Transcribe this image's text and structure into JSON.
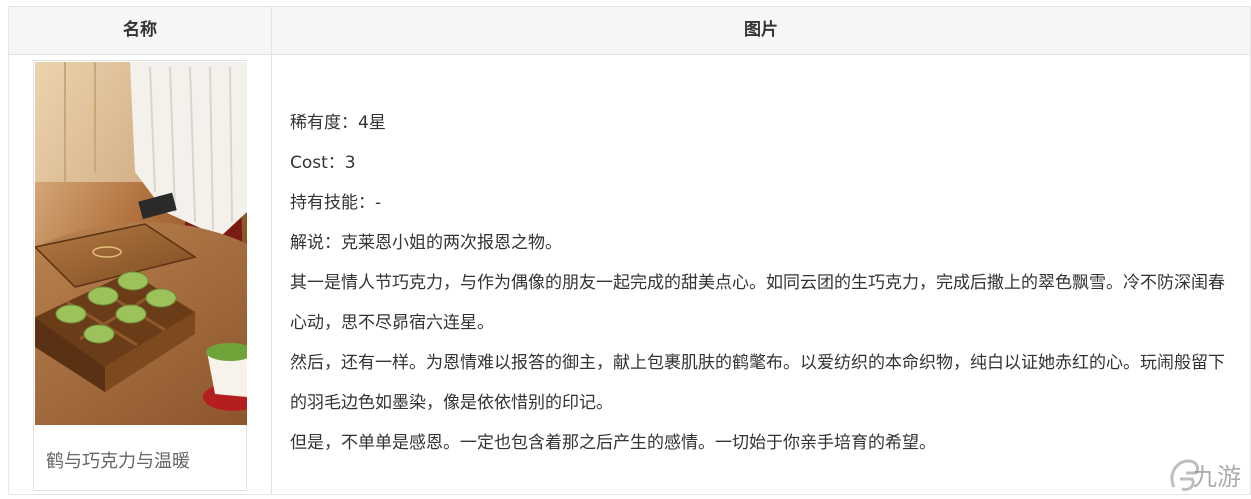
{
  "table": {
    "headers": {
      "name": "名称",
      "image": "图片"
    }
  },
  "card": {
    "caption": "鹤与巧克力与温暖"
  },
  "details": {
    "rarity": "稀有度：4星",
    "cost": "Cost：3",
    "skill": "持有技能：-",
    "intro": "解说：克莱恩小姐的两次报恩之物。",
    "para1": "其一是情人节巧克力，与作为偶像的朋友一起完成的甜美点心。如同云团的生巧克力，完成后撒上的翠色飘雪。冷不防深闺春心动，思不尽昴宿六连星。",
    "para2": "然后，还有一样。为恩情难以报答的御主，献上包裹肌肤的鹤氅布。以爱纺织的本命织物，纯白以证她赤红的心。玩闹般留下的羽毛边色如墨染，像是依依惜别的印记。",
    "para3": "但是，不单单是感恩。一定也包含着那之后产生的感情。一切始于你亲手培育的希望。"
  },
  "watermark": {
    "text": "九游"
  }
}
